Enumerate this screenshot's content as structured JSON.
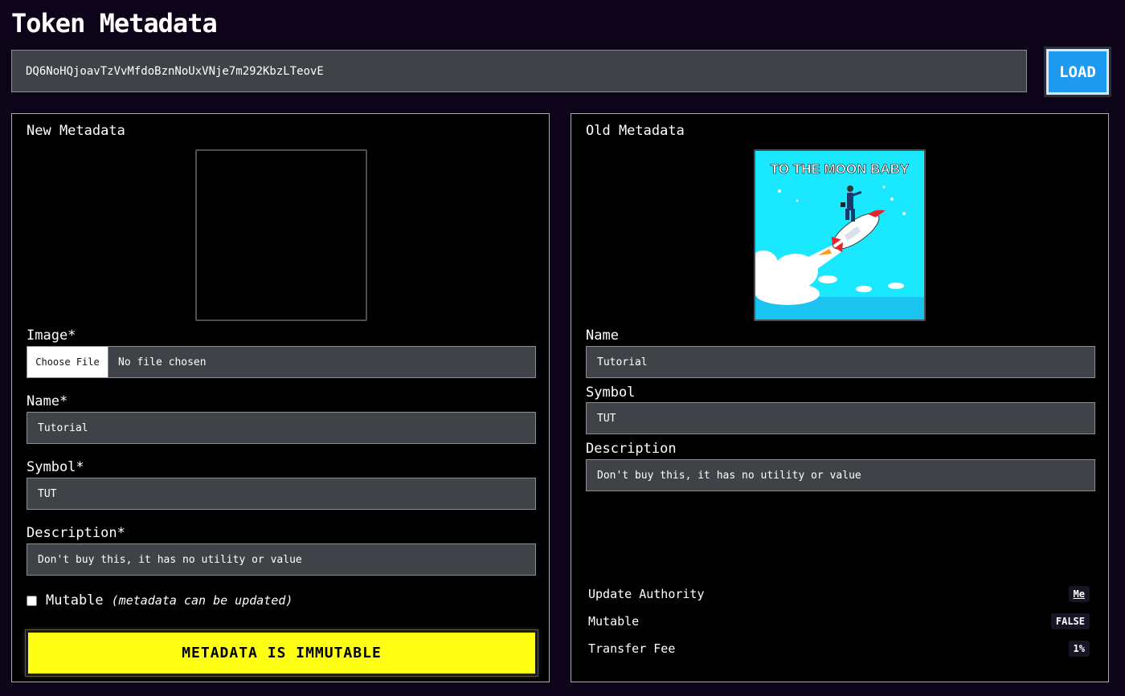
{
  "header": {
    "title": "Token Metadata",
    "mint_address": "DQ6NoHQjoavTzVvMfdoBznNoUxVNje7m292KbzLTeovE",
    "load_label": "LOAD"
  },
  "new_metadata": {
    "title": "New Metadata",
    "image_label": "Image*",
    "choose_file_label": "Choose File",
    "file_status": "No file chosen",
    "name_label": "Name*",
    "name_value": "Tutorial",
    "symbol_label": "Symbol*",
    "symbol_value": "TUT",
    "description_label": "Description*",
    "description_value": "Don't buy this, it has no utility or value",
    "mutable_label": "Mutable",
    "mutable_hint": "(metadata can be updated)",
    "submit_label": "METADATA IS IMMUTABLE"
  },
  "old_metadata": {
    "title": "Old Metadata",
    "image_caption": "TO THE MOON BABY",
    "name_label": "Name",
    "name_value": "Tutorial",
    "symbol_label": "Symbol",
    "symbol_value": "TUT",
    "description_label": "Description",
    "description_value": "Don't buy this, it has no utility or value",
    "info": [
      {
        "label": "Update Authority",
        "value": "Me"
      },
      {
        "label": "Mutable",
        "value": "FALSE"
      },
      {
        "label": "Transfer Fee",
        "value": "1%"
      }
    ]
  },
  "colors": {
    "background": "#0e0419",
    "panel": "#000000",
    "input": "#3f4348",
    "load_button": "#1e9bf0",
    "submit_button": "#ffff14",
    "image_sky": "#19e8ff"
  }
}
